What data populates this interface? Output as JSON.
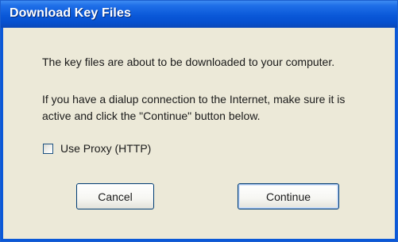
{
  "window": {
    "title": "Download Key Files"
  },
  "message": {
    "line1": "The key files are about to be downloaded to your computer.",
    "line2": "If you have a dialup connection to the Internet, make sure it is",
    "line3": "active and click the \"Continue\" button below."
  },
  "options": {
    "use_proxy_label": "Use Proxy (HTTP)",
    "use_proxy_checked": false
  },
  "buttons": {
    "cancel_label": "Cancel",
    "continue_label": "Continue"
  },
  "colors": {
    "titlebar": "#0a58d8",
    "dialog_background": "#ece9d8",
    "title_text": "#ffffff"
  }
}
